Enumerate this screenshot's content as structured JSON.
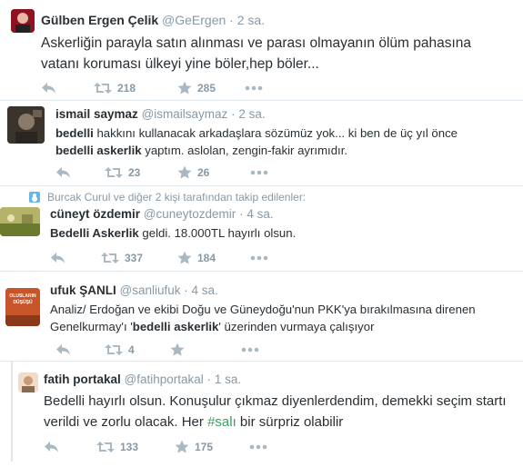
{
  "tweets": [
    {
      "name": "Gülben Ergen Çelik",
      "handle": "@GeErgen",
      "separator": "·",
      "time": "2 sa.",
      "text_parts": [
        {
          "text": "Askerliğin parayla satın alınması ve parası olmayanın ölüm pahasına vatanı koruması ülkeyi yine böler,hep böler...",
          "style": "normal"
        }
      ],
      "retweets": "218",
      "likes": "285",
      "avatar_color": "#b11e2f"
    },
    {
      "name": "ismail saymaz",
      "handle": "@ismailsaymaz",
      "separator": "·",
      "time": "2 sa.",
      "text_parts": [
        {
          "text": "bedelli",
          "style": "bold"
        },
        {
          "text": " hakkını kullanacak arkadaşlara sözümüz yok... ki ben de üç yıl önce ",
          "style": "normal"
        },
        {
          "text": "bedelli askerlik",
          "style": "bold"
        },
        {
          "text": " yaptım. aslolan, zengin-fakir ayrımıdır.",
          "style": "normal"
        }
      ],
      "retweets": "23",
      "likes": "26",
      "avatar_color": "#4a4036"
    },
    {
      "context": "Burcak Curul ve diğer 2 kişi tarafından takip edilenler:",
      "name": "cüneyt özdemir",
      "handle": "@cuneytozdemir",
      "separator": "·",
      "time": "4 sa.",
      "text_parts": [
        {
          "text": "Bedelli Askerlik",
          "style": "bold"
        },
        {
          "text": " geldi. 18.000TL hayırlı olsun.",
          "style": "normal"
        }
      ],
      "retweets": "337",
      "likes": "184",
      "avatar_color": "#7a8a3a"
    },
    {
      "name": "ufuk ŞANLI",
      "handle": "@sanliufuk",
      "separator": "·",
      "time": "4 sa.",
      "avatar_text": "OLUSLARIN DÜŞÜŞÜ",
      "text_parts": [
        {
          "text": "Analiz/ Erdoğan ve ekibi Doğu ve Güneydoğu'nun PKK'ya bırakılmasına direnen Genelkurmay'ı '",
          "style": "normal"
        },
        {
          "text": "bedelli askerlik",
          "style": "bold"
        },
        {
          "text": "' üzerinden vurmaya çalışıyor",
          "style": "normal"
        }
      ],
      "retweets": "4",
      "likes": "",
      "avatar_color": "#c04a1f"
    },
    {
      "name": "fatih portakal",
      "handle": "@fatihportakal",
      "separator": "·",
      "time": "1 sa.",
      "text_parts": [
        {
          "text": "Bedelli hayırlı olsun. Konuşulur çıkmaz diyenlerdendim, demekki seçim startı verildi ve zorlu olacak. Her ",
          "style": "normal"
        },
        {
          "text": "#salı",
          "style": "hashtag"
        },
        {
          "text": " bir sürpriz olabilir",
          "style": "normal"
        }
      ],
      "retweets": "133",
      "likes": "175",
      "avatar_color": "#e7c3a3"
    }
  ],
  "icons": {
    "reply": "reply-icon",
    "retweet": "retweet-icon",
    "like": "star-icon",
    "more": "more-dots-icon",
    "context": "follow-context-icon"
  },
  "colors": {
    "text": "#292f33",
    "muted": "#8899a6",
    "divider": "#e1e8ed",
    "hashtag": "#3b9e61"
  }
}
